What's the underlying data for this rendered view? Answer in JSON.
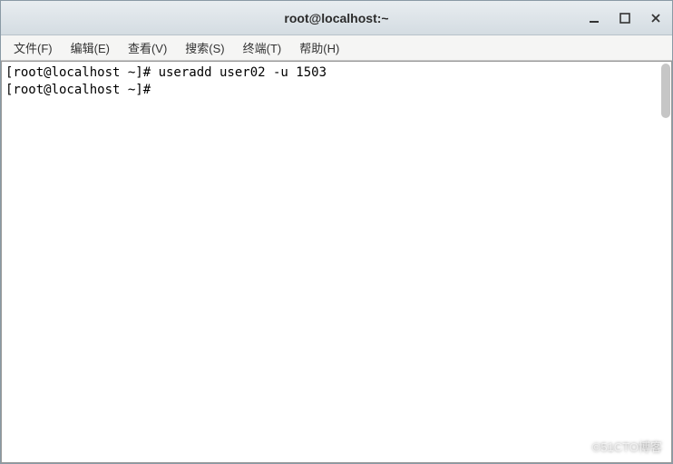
{
  "titlebar": {
    "title": "root@localhost:~"
  },
  "menubar": {
    "items": [
      {
        "label": "文件(F)"
      },
      {
        "label": "编辑(E)"
      },
      {
        "label": "查看(V)"
      },
      {
        "label": "搜索(S)"
      },
      {
        "label": "终端(T)"
      },
      {
        "label": "帮助(H)"
      }
    ]
  },
  "terminal": {
    "lines": [
      "[root@localhost ~]# useradd user02 -u 1503",
      "[root@localhost ~]# "
    ]
  },
  "watermark": "©51CTO博客"
}
